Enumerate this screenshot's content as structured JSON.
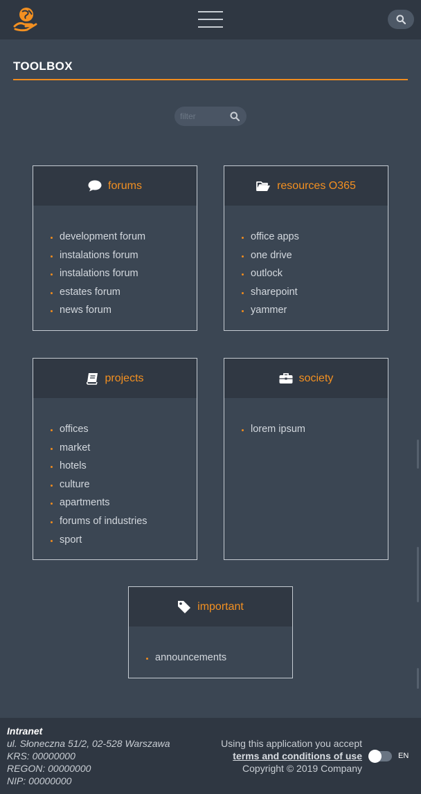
{
  "header": {
    "logo_icon": "globe-hand-icon",
    "menu_icon": "hamburger-menu-icon",
    "search_icon": "search-icon"
  },
  "section": {
    "title": "TOOLBOX"
  },
  "filter": {
    "placeholder": "filter",
    "icon": "search-icon"
  },
  "cards": {
    "forums": {
      "icon": "speech-bubble-icon",
      "title": "forums",
      "items": [
        "development forum",
        "instalations forum",
        "instalations forum",
        "estates forum",
        "news forum"
      ]
    },
    "resources": {
      "icon": "folder-open-icon",
      "title": "resources O365",
      "items": [
        "office apps",
        "one drive",
        "outlock",
        "sharepoint",
        "yammer"
      ]
    },
    "projects": {
      "icon": "book-icon",
      "title": "projects",
      "items": [
        "offices",
        "market",
        "hotels",
        "culture",
        "apartments",
        "forums of industries",
        "sport"
      ]
    },
    "society": {
      "icon": "briefcase-icon",
      "title": "society",
      "items": [
        "lorem ipsum"
      ]
    },
    "important": {
      "icon": "tag-icon",
      "title": "important",
      "items": [
        "announcements"
      ]
    }
  },
  "footer": {
    "brand": "Intranet",
    "address": "ul. Słoneczna 51/2, 02-528 Warszawa",
    "krs": "KRS: 00000000",
    "regon": "REGON: 00000000",
    "nip": "NIP: 00000000",
    "accept_text": "Using this application you accept",
    "terms_link": "terms and conditions of use",
    "copyright": "Copyright © 2019 Company",
    "language": "EN",
    "toggle_state": "off"
  },
  "colors": {
    "accent": "#f08c1e",
    "background": "#3b4653",
    "bar": "#2f3742"
  }
}
